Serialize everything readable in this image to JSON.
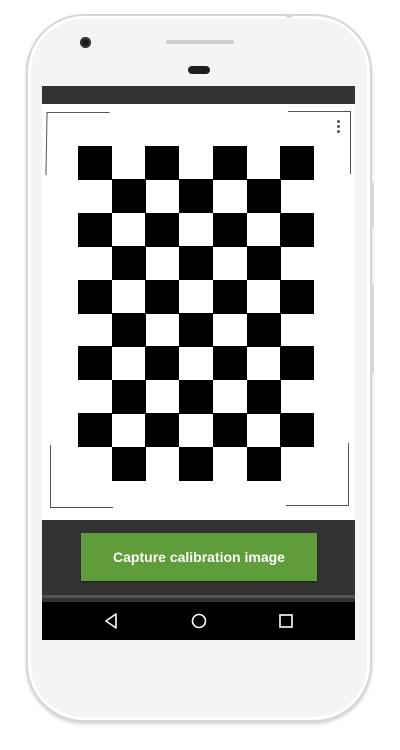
{
  "device": {
    "body_color": "#f4f4f4",
    "bezel_color": "#d6d6d6"
  },
  "viewfinder": {
    "menu_icon": "more-vert-icon",
    "pattern": {
      "type": "checkerboard",
      "columns": 7,
      "rows": 10,
      "square_color": "#000000"
    }
  },
  "capture_button": {
    "label": "Capture calibration image",
    "color": "#5f9c3a"
  },
  "nav_bar": {
    "back_icon": "back-triangle-icon",
    "home_icon": "home-circle-icon",
    "recents_icon": "recents-square-icon"
  }
}
